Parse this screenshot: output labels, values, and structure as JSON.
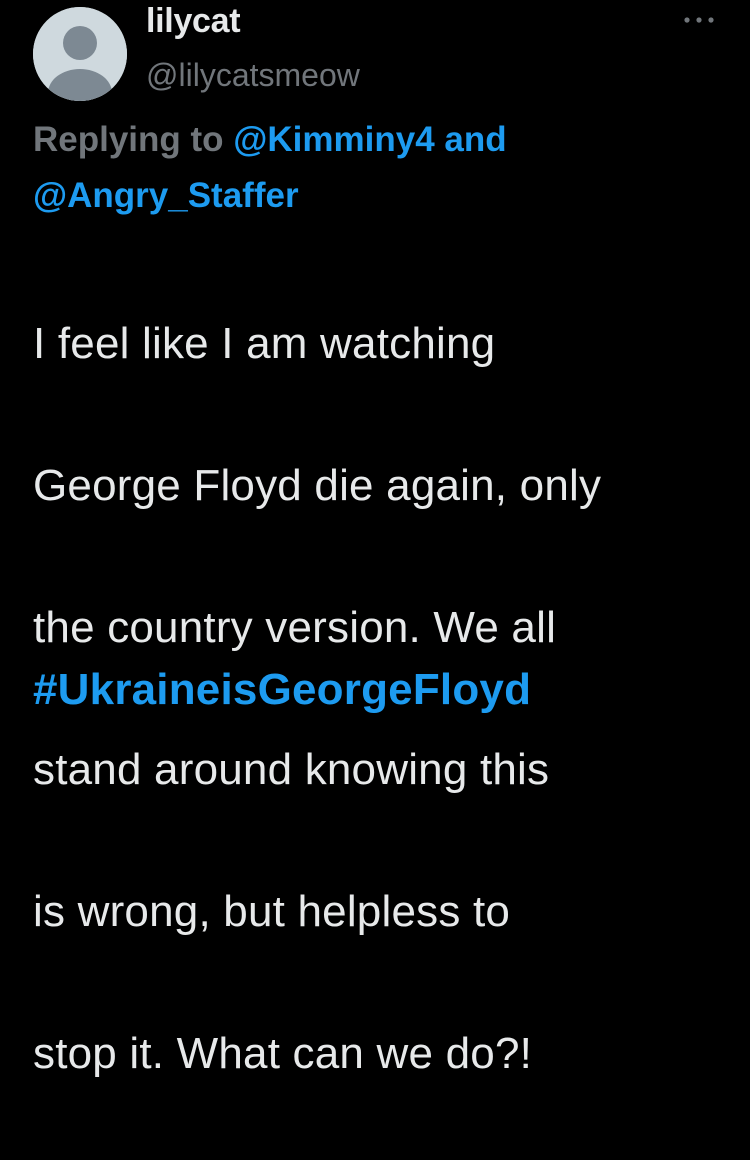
{
  "author": {
    "display_name": "lilycat",
    "handle": "@lilycatsmeow",
    "avatar_icon": "default-avatar-icon"
  },
  "more_icon": "more-dots-icon",
  "reply_context": {
    "prefix": "Replying to ",
    "mentions": [
      "@Kimminy4",
      "@Angry_Staffer"
    ],
    "joiner": " and "
  },
  "tweet": {
    "text_lines": [
      "I feel like I am watching",
      "George Floyd die again, only",
      "the country version.  We all",
      "stand around knowing this",
      "is wrong, but helpless to",
      "stop it.  What can we do?!"
    ],
    "hashtag": "#UkraineisGeorgeFloyd"
  },
  "colors": {
    "background": "#000000",
    "primary_text": "#e7e9ea",
    "secondary_text": "#71767b",
    "accent": "#1d9bf0",
    "avatar_bg": "#cfd9de",
    "avatar_fg": "#7d8993"
  }
}
